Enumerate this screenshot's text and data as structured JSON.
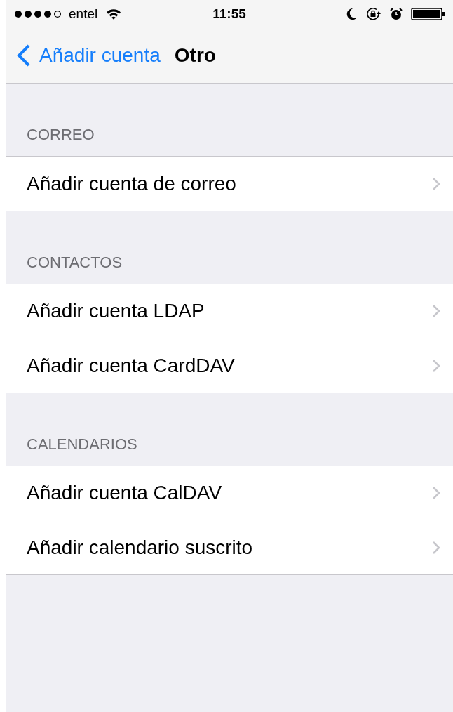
{
  "status_bar": {
    "carrier": "entel",
    "time": "11:55"
  },
  "nav_bar": {
    "back_label": "Añadir cuenta",
    "title": "Otro"
  },
  "sections": [
    {
      "header": "CORREO",
      "rows": [
        {
          "label": "Añadir cuenta de correo"
        }
      ]
    },
    {
      "header": "CONTACTOS",
      "rows": [
        {
          "label": "Añadir cuenta LDAP"
        },
        {
          "label": "Añadir cuenta CardDAV"
        }
      ]
    },
    {
      "header": "CALENDARIOS",
      "rows": [
        {
          "label": "Añadir cuenta CalDAV"
        },
        {
          "label": "Añadir calendario suscrito"
        }
      ]
    }
  ]
}
